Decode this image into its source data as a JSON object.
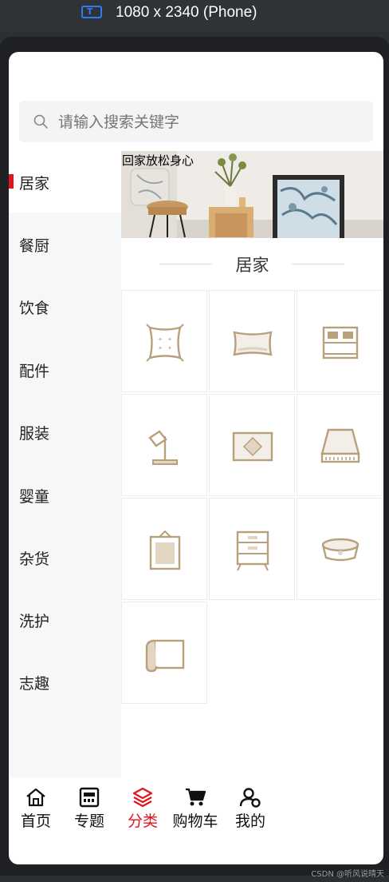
{
  "device": {
    "label": "1080 x 2340 (Phone)"
  },
  "search": {
    "placeholder": "请输入搜索关键字"
  },
  "sidebar": {
    "items": [
      {
        "label": "居家",
        "active": true
      },
      {
        "label": "餐厨"
      },
      {
        "label": "饮食"
      },
      {
        "label": "配件"
      },
      {
        "label": "服装"
      },
      {
        "label": "婴童"
      },
      {
        "label": "杂货"
      },
      {
        "label": "洗护"
      },
      {
        "label": "志趣"
      }
    ]
  },
  "banner": {
    "text": "回家放松身心"
  },
  "section": {
    "title": "居家"
  },
  "grid": {
    "items": [
      {
        "icon": "cushion-icon"
      },
      {
        "icon": "pillow-icon"
      },
      {
        "icon": "bed-icon"
      },
      {
        "icon": "lamp-icon"
      },
      {
        "icon": "rug-icon"
      },
      {
        "icon": "mattress-icon"
      },
      {
        "icon": "frame-icon"
      },
      {
        "icon": "cabinet-icon"
      },
      {
        "icon": "pet-bowl-icon"
      },
      {
        "icon": "scroll-icon"
      }
    ]
  },
  "tabbar": {
    "tabs": [
      {
        "label": "首页",
        "icon": "home-icon"
      },
      {
        "label": "专题",
        "icon": "topic-icon"
      },
      {
        "label": "分类",
        "icon": "category-icon",
        "active": true
      },
      {
        "label": "购物车",
        "icon": "cart-icon"
      },
      {
        "label": "我的",
        "icon": "user-icon"
      }
    ]
  },
  "colors": {
    "accent": "#e0141e",
    "icon": "#b9a07c",
    "sidebar_bg": "#f6f7f9"
  },
  "watermark": "CSDN @听风说晴天"
}
